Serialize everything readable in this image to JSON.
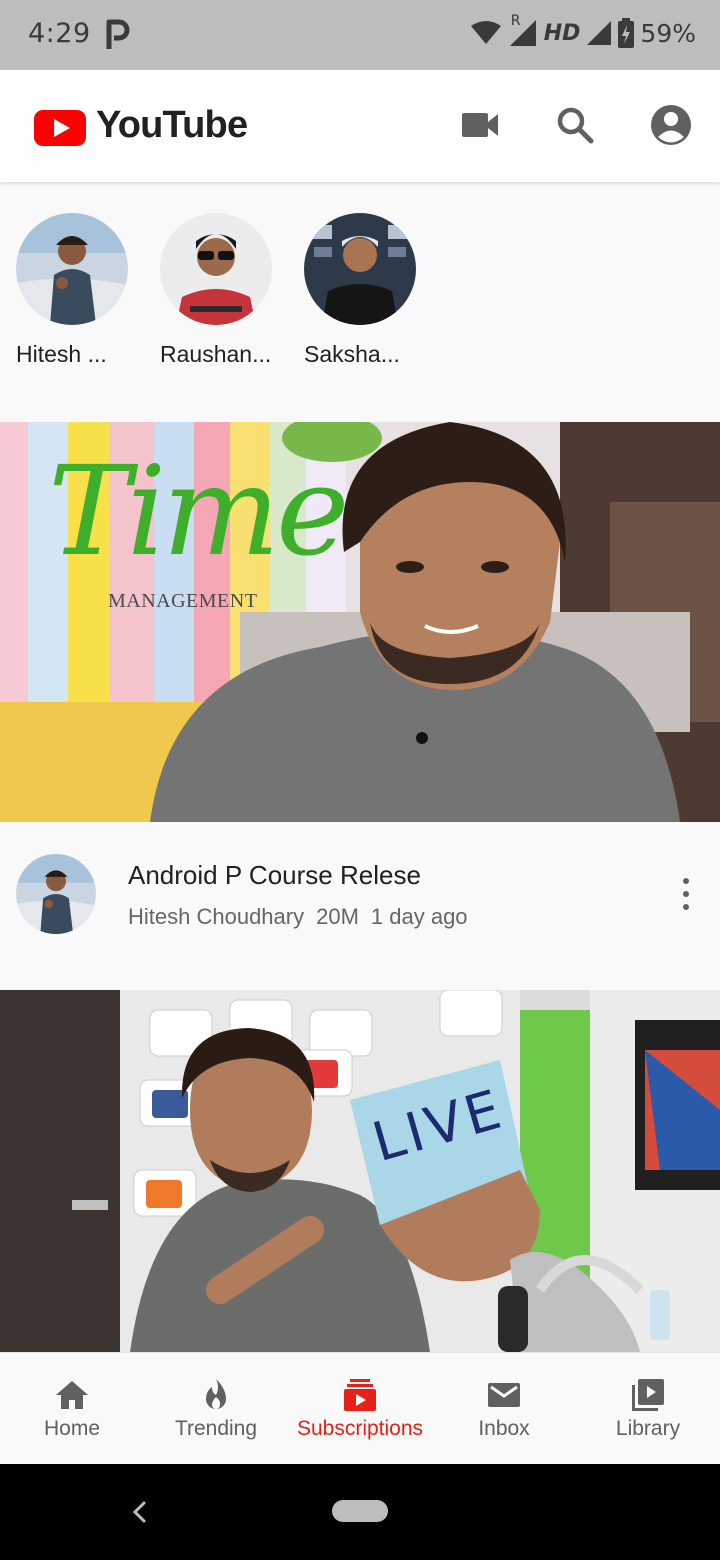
{
  "status_bar": {
    "time": "4:29",
    "network": "HD",
    "roaming": "R",
    "battery": "59%"
  },
  "app_bar": {
    "title": "YouTube",
    "brand_color": "#ff0000",
    "icons": [
      "video-camera-icon",
      "search-icon",
      "account-icon"
    ]
  },
  "channels": [
    {
      "name": "Hitesh ...",
      "avatar": "hitesh-avatar"
    },
    {
      "name": "Raushan...",
      "avatar": "raushan-avatar"
    },
    {
      "name": "Saksha...",
      "avatar": "saksham-avatar"
    }
  ],
  "videos": [
    {
      "thumbnail_text": "Time",
      "thumbnail_subtext": "MANAGEMENT",
      "title": "Android P Course Relese",
      "channel": "Hitesh Choudhary",
      "views": "20M",
      "age": "1 day ago"
    },
    {
      "thumbnail_text": "LIVE"
    }
  ],
  "bottom_nav": {
    "items": [
      {
        "label": "Home",
        "icon": "home-icon"
      },
      {
        "label": "Trending",
        "icon": "flame-icon"
      },
      {
        "label": "Subscriptions",
        "icon": "subscriptions-icon"
      },
      {
        "label": "Inbox",
        "icon": "mail-icon"
      },
      {
        "label": "Library",
        "icon": "library-icon"
      }
    ],
    "active": "Subscriptions",
    "active_color": "#e62117"
  }
}
